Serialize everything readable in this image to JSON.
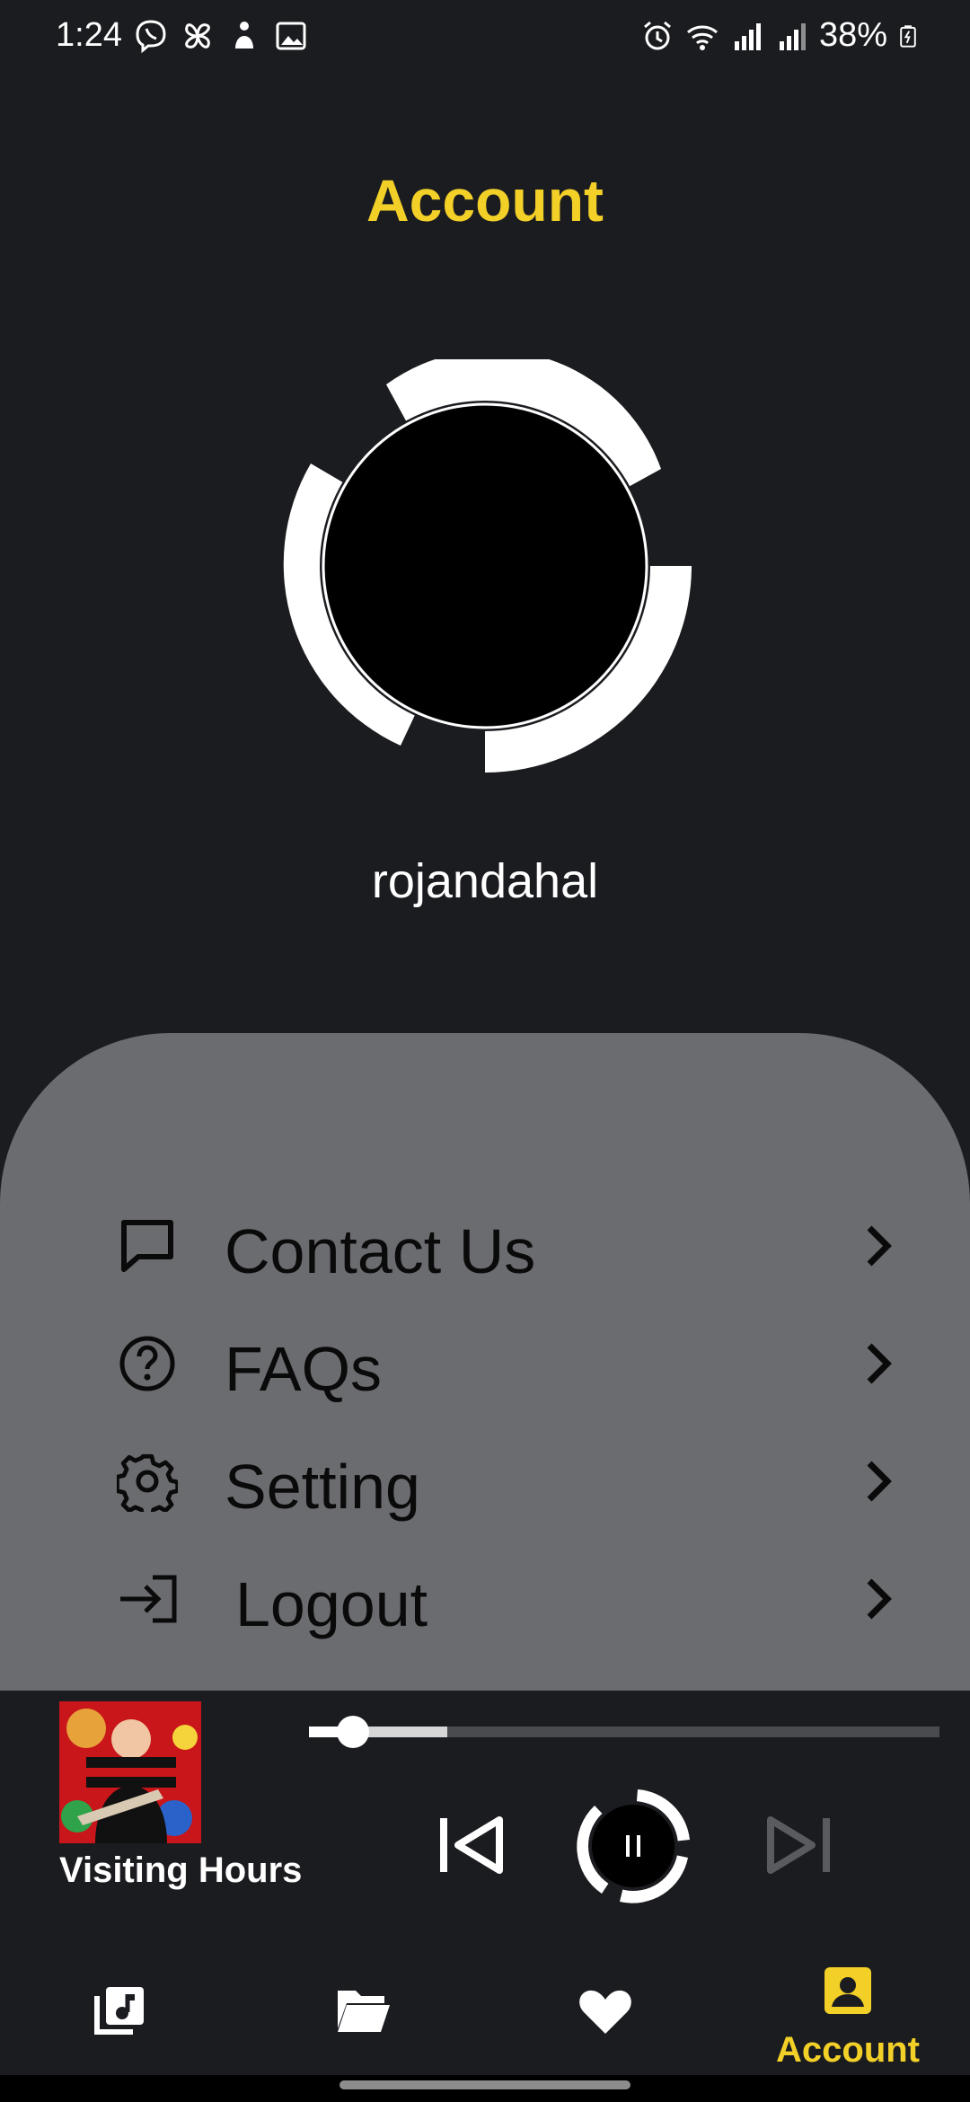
{
  "status_bar": {
    "time": "1:24",
    "battery": "38%",
    "left_icons": [
      "viber-icon",
      "pinwheel-icon",
      "figure-icon",
      "image-icon"
    ],
    "right_icons": [
      "alarm-icon",
      "wifi-icon",
      "signal-icon",
      "signal-icon",
      "battery-charging-icon"
    ]
  },
  "header": {
    "title": "Account"
  },
  "profile": {
    "username": "rojandahal"
  },
  "menu": {
    "items": [
      {
        "label": "Contact Us",
        "icon": "chat-bubble-icon"
      },
      {
        "label": "FAQs",
        "icon": "question-circle-icon"
      },
      {
        "label": "Setting",
        "icon": "gear-icon"
      },
      {
        "label": "Logout",
        "icon": "logout-icon"
      }
    ]
  },
  "player": {
    "track_title": "Visiting Hours",
    "progress_played": 0.07,
    "progress_buffered": 0.22,
    "state": "playing"
  },
  "bottom_nav": {
    "items": [
      {
        "label": "",
        "icon": "music-library-icon",
        "active": false
      },
      {
        "label": "",
        "icon": "folder-icon",
        "active": false
      },
      {
        "label": "",
        "icon": "heart-icon",
        "active": false
      },
      {
        "label": "Account",
        "icon": "account-icon",
        "active": true
      }
    ]
  },
  "colors": {
    "background": "#1b1c20",
    "accent": "#f2d028",
    "panel": "#6b6c70"
  }
}
